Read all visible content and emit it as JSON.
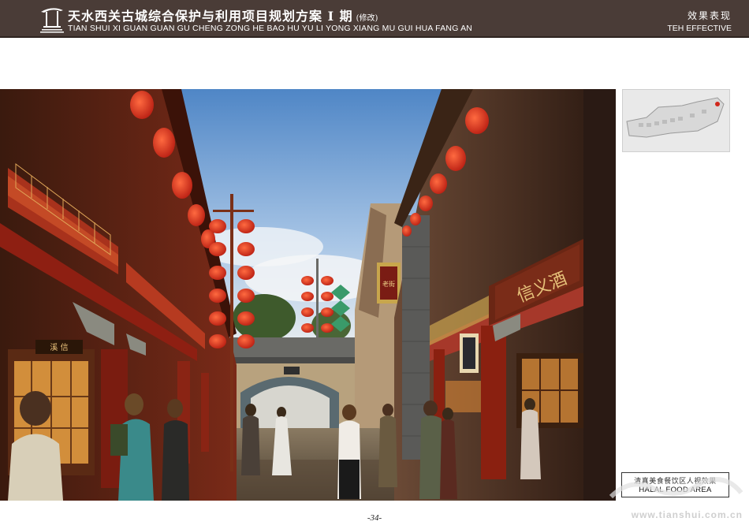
{
  "header": {
    "title_cn": "天水西关古城综合保护与利用项目规划方案 I 期",
    "title_note": "(修改)",
    "title_pinyin": "TIAN SHUI XI GUAN GUAN GU CHENG ZONG HE BAO HU YU LI YONG XIANG MU GUI HUA FANG AN",
    "section_cn": "效果表现",
    "section_en": "TEH EFFECTIVE"
  },
  "rendering": {
    "signs": {
      "wine_shop": "信义酒",
      "left_shop": "溪 信",
      "banner": "老街"
    }
  },
  "caption": {
    "cn": "清真美食餐饮区人视效果",
    "en": "HALAL FOOD AREA"
  },
  "page_number": "-34-",
  "watermark": "www.tianshui.com.cn",
  "colors": {
    "header_bg": "#4a3c37",
    "lantern_red": "#d8291c",
    "timber_red": "#8e1f12",
    "sky_blue": "#7fa9d8"
  }
}
